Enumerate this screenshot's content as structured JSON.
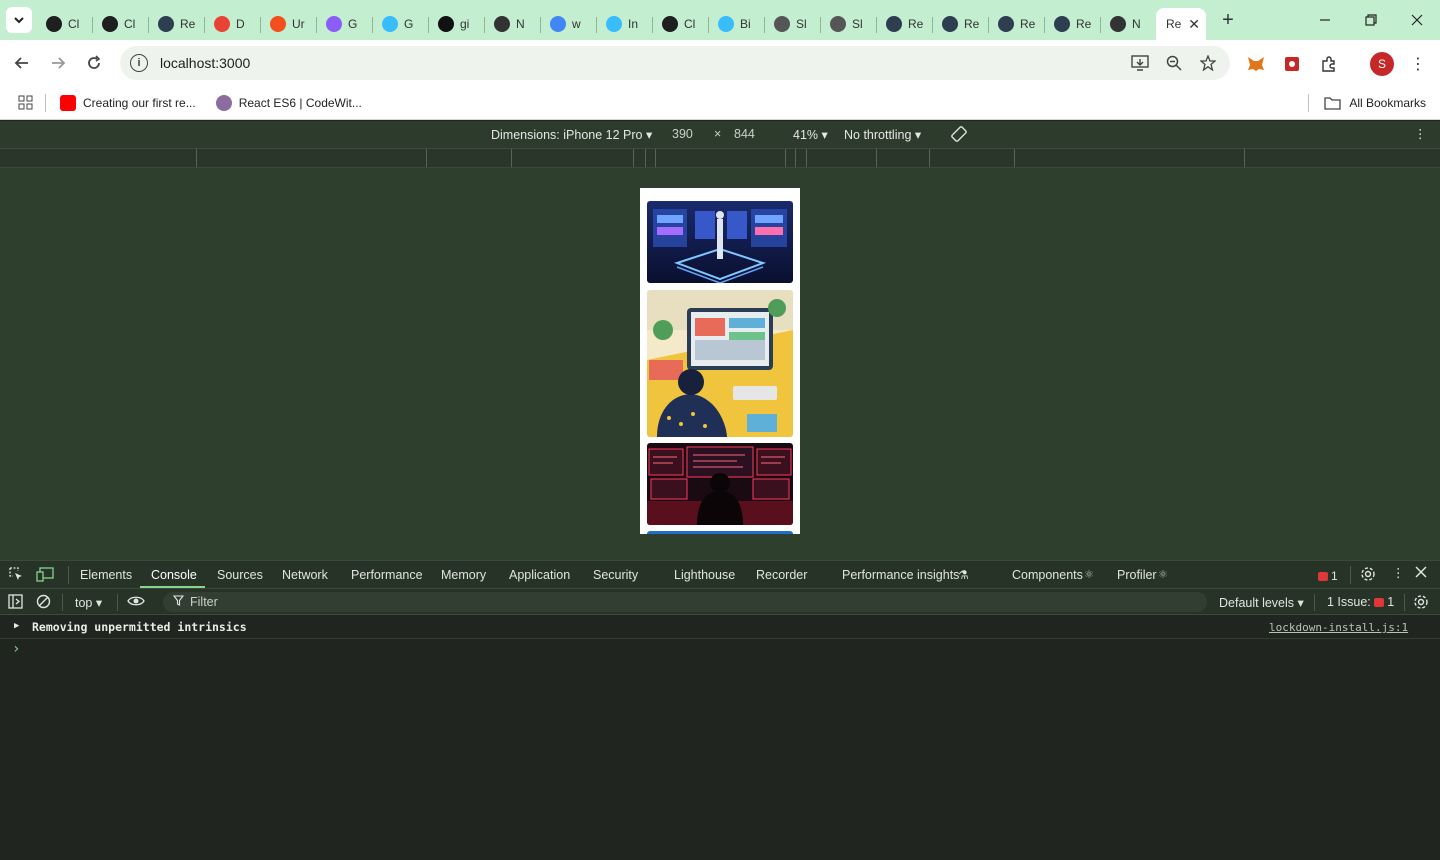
{
  "browser": {
    "tabs": [
      {
        "label": "Cl",
        "icon": "openai-icon",
        "color": "#1f1f1f"
      },
      {
        "label": "Cl",
        "icon": "openai-icon",
        "color": "#1f1f1f"
      },
      {
        "label": "Re",
        "icon": "react-icon",
        "color": "#2c3e50"
      },
      {
        "label": "D",
        "icon": "gmail-icon",
        "color": "#ea4335"
      },
      {
        "label": "Ur",
        "icon": "figma-icon",
        "color": "#f24e1e"
      },
      {
        "label": "G",
        "icon": "vite-icon",
        "color": "#8b5cf6"
      },
      {
        "label": "G",
        "icon": "tailwind-icon",
        "color": "#38bdf8"
      },
      {
        "label": "gi",
        "icon": "medium-icon",
        "color": "#111111"
      },
      {
        "label": "N",
        "icon": "nextjs-icon",
        "color": "#333333"
      },
      {
        "label": "w",
        "icon": "google-icon",
        "color": "#4285f4"
      },
      {
        "label": "In",
        "icon": "tailwind-icon",
        "color": "#38bdf8"
      },
      {
        "label": "Cl",
        "icon": "openai-icon",
        "color": "#1f1f1f"
      },
      {
        "label": "Bi",
        "icon": "tailwind-icon",
        "color": "#38bdf8"
      },
      {
        "label": "Sl",
        "icon": "github-icon",
        "color": "#555555"
      },
      {
        "label": "Sl",
        "icon": "github-icon",
        "color": "#555555"
      },
      {
        "label": "Re",
        "icon": "react-icon",
        "color": "#2c3e50"
      },
      {
        "label": "Re",
        "icon": "react-icon",
        "color": "#2c3e50"
      },
      {
        "label": "Re",
        "icon": "react-icon",
        "color": "#2c3e50"
      },
      {
        "label": "Re",
        "icon": "react-icon",
        "color": "#2c3e50"
      },
      {
        "label": "N",
        "icon": "nextjs-icon",
        "color": "#333333"
      }
    ],
    "active_tab": {
      "label": "Re",
      "close": "✕"
    },
    "new_tab": "+",
    "url": "localhost:3000",
    "profile_initial": "S",
    "bookmarks": [
      {
        "label": "Creating our first re...",
        "icon": "youtube-icon",
        "color": "#ff0000"
      },
      {
        "label": "React ES6 | CodeWit...",
        "icon": "avatar-icon",
        "color": "#8a6d9e"
      }
    ],
    "all_bookmarks": "All Bookmarks"
  },
  "device_toolbar": {
    "dimensions": "Dimensions: iPhone 12 Pro",
    "width": "390",
    "times": "×",
    "height": "844",
    "zoom": "41%",
    "throttling": "No throttling"
  },
  "devtools": {
    "tabs": [
      "Elements",
      "Console",
      "Sources",
      "Network",
      "Performance",
      "Memory",
      "Application",
      "Security",
      "Lighthouse",
      "Recorder",
      "Performance insights",
      "Components",
      "Profiler"
    ],
    "active_tab": "Console",
    "error_count": "1",
    "context": "top",
    "filter_placeholder": "Filter",
    "levels": "Default levels",
    "issues": "1 Issue:",
    "issues_count": "1",
    "console_messages": [
      {
        "text": "Removing unpermitted intrinsics",
        "source": "lockdown-install.js:1"
      }
    ],
    "prompt": "›"
  }
}
